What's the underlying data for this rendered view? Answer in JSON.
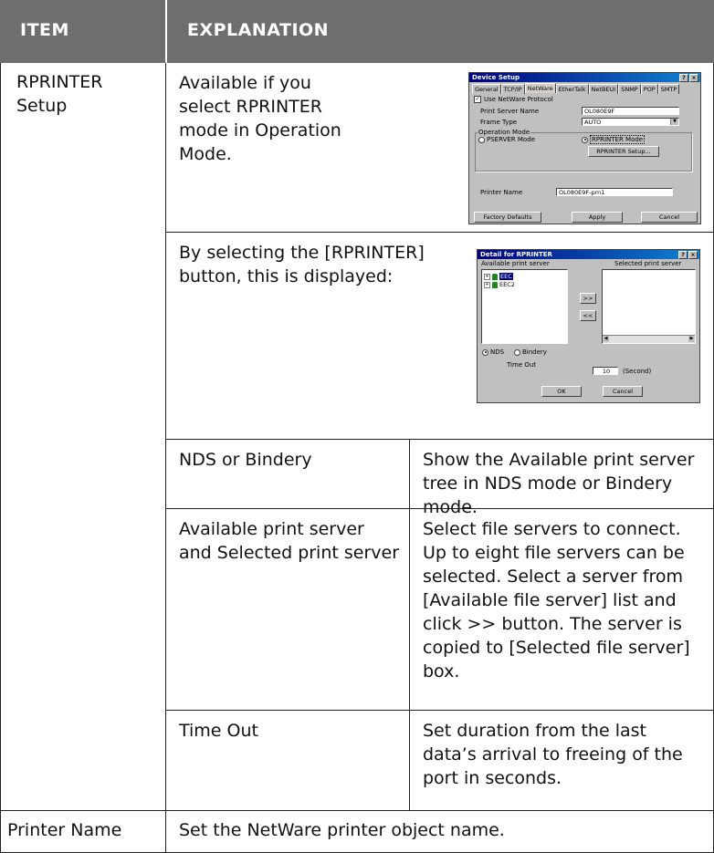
{
  "table": {
    "header": {
      "item": "ITEM",
      "explanation": "EXPLANATION"
    },
    "rows": {
      "rprinter_setup": {
        "item": "RPRINTER Setup",
        "desc1": "Available if you select RPRINTER mode in Operation Mode.",
        "desc2": "By selecting the [RPRINTER] button, this is displayed:",
        "sub": [
          {
            "name": "NDS or Bindery",
            "desc": "Show the Available print server tree in NDS mode or Bindery mode."
          },
          {
            "name": "Available print server and Selected print server",
            "desc": "Select file servers to connect. Up to eight file servers can be selected. Select a server from [Available file server] list and click >> button. The server is copied to [Selected file server] box."
          },
          {
            "name": "Time Out",
            "desc": "Set duration from the last data’s arrival to freeing of the port in seconds."
          }
        ]
      },
      "printer_name": {
        "item": "Printer Name",
        "desc": "Set the NetWare printer object name."
      }
    }
  },
  "device_setup_dialog": {
    "title": "Device Setup",
    "title_buttons": [
      "?",
      "×"
    ],
    "tabs": [
      "General",
      "TCP/IP",
      "NetWare",
      "EtherTalk",
      "NetBEUI",
      "SNMP",
      "POP",
      "SMTP"
    ],
    "active_tab": "NetWare",
    "use_netware": "Use NetWare Protocol",
    "print_server_name_label": "Print Server Name",
    "print_server_name_value": "OL080E9F",
    "frame_type_label": "Frame Type",
    "frame_type_value": "AUTO",
    "operation_mode_label": "Operation Mode",
    "pserver_mode": "PSERVER Mode",
    "rprinter_mode": "RPRINTER Mode",
    "rprinter_setup_button": "RPRINTER Setup...",
    "printer_name_label": "Printer Name",
    "printer_name_value": "OL080E9F-prn1",
    "factory_defaults_button": "Factory Defaults",
    "apply_button": "Apply",
    "cancel_button": "Cancel"
  },
  "rprinter_dialog": {
    "title": "Detail for RPRINTER",
    "title_buttons": [
      "?",
      "×"
    ],
    "available_label": "Available print server",
    "selected_label": "Selected print server",
    "tree_items": [
      "EEC",
      "EEC2"
    ],
    "add_button": ">>",
    "remove_button": "<<",
    "nds_label": "NDS",
    "bindery_label": "Bindery",
    "timeout_label": "Time Out",
    "timeout_value": "10",
    "timeout_unit": "(Second)",
    "ok_button": "OK",
    "cancel_button": "Cancel"
  }
}
